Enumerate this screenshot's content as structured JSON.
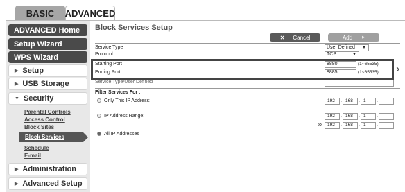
{
  "tabs": {
    "basic": "BASIC",
    "advanced": "ADVANCED"
  },
  "sidebar": {
    "items": [
      {
        "label": "ADVANCED Home"
      },
      {
        "label": "Setup Wizard"
      },
      {
        "label": "WPS Wizard"
      },
      {
        "label": "Setup"
      },
      {
        "label": "USB Storage"
      },
      {
        "label": "Security"
      },
      {
        "label": "Administration"
      },
      {
        "label": "Advanced Setup"
      }
    ],
    "security_links": [
      "Parental Controls",
      "Access Control",
      "Block Sites",
      "Block Services",
      "Schedule",
      "E-mail"
    ]
  },
  "page": {
    "title": "Block Services Setup",
    "cancel_label": "Cancel",
    "add_label": "Add"
  },
  "form": {
    "service_type_label": "Service Type",
    "service_type_value": "User Defined",
    "protocol_label": "Protocol",
    "protocol_value": "TCP",
    "starting_port_label": "Starting Port",
    "starting_port_value": "8880",
    "starting_port_range": "(1~65535)",
    "ending_port_label": "Ending Port",
    "ending_port_value": "8885",
    "ending_port_range": "(1~65535)",
    "service_type_defined_label": "Service Type/User Defined"
  },
  "filter": {
    "title": "Filter Services For :",
    "only_ip_label": "Only This IP Address:",
    "only_ip": [
      "192",
      "168",
      "1",
      ""
    ],
    "range_label": "IP Address Range:",
    "range_from": [
      "192",
      "168",
      "1",
      ""
    ],
    "to_label": "to",
    "range_to": [
      "192",
      "168",
      "1",
      ""
    ],
    "all_ip_label": "All IP Addresses",
    "selected": "all"
  }
}
